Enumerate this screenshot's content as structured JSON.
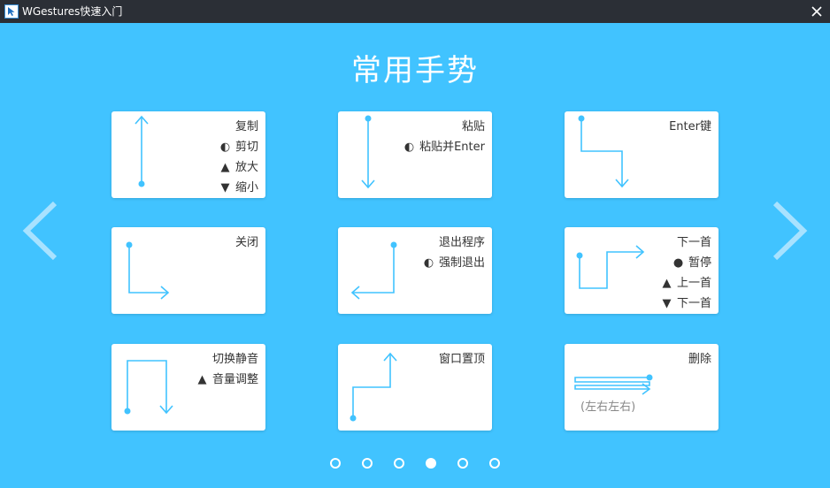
{
  "window": {
    "title": "WGestures快速入门",
    "icons": {
      "app": "wgestures-app-icon",
      "close": "close-icon"
    }
  },
  "page": {
    "heading": "常用手势"
  },
  "theme": {
    "background": "#41c3ff",
    "gesture_color": "#41c3ff",
    "titlebar": "#2b2f36",
    "card": "#ffffff"
  },
  "cards": [
    {
      "lines": [
        {
          "mark": "",
          "text": "复制"
        },
        {
          "mark": "◐",
          "text": "剪切"
        },
        {
          "mark": "▲",
          "text": "放大"
        },
        {
          "mark": "▼",
          "text": "缩小"
        }
      ]
    },
    {
      "lines": [
        {
          "mark": "",
          "text": "粘贴"
        },
        {
          "mark": "◐",
          "text": "粘贴并Enter"
        }
      ]
    },
    {
      "lines": [
        {
          "mark": "",
          "text": "Enter键"
        }
      ]
    },
    {
      "lines": [
        {
          "mark": "",
          "text": "关闭"
        }
      ]
    },
    {
      "lines": [
        {
          "mark": "",
          "text": "退出程序"
        },
        {
          "mark": "◐",
          "text": "强制退出"
        }
      ]
    },
    {
      "lines": [
        {
          "mark": "",
          "text": "下一首"
        },
        {
          "mark": "●",
          "text": "暂停"
        },
        {
          "mark": "▲",
          "text": "上一首"
        },
        {
          "mark": "▼",
          "text": "下一首"
        }
      ]
    },
    {
      "lines": [
        {
          "mark": "",
          "text": "切换静音"
        },
        {
          "mark": "▲",
          "text": "音量调整"
        }
      ]
    },
    {
      "lines": [
        {
          "mark": "",
          "text": "窗口置顶"
        }
      ]
    },
    {
      "lines": [
        {
          "mark": "",
          "text": "删除"
        }
      ],
      "note": "(左右左右)"
    }
  ],
  "pagination": {
    "total": 6,
    "current": 4
  },
  "nav": {
    "prev_icon": "chevron-left-icon",
    "next_icon": "chevron-right-icon"
  }
}
